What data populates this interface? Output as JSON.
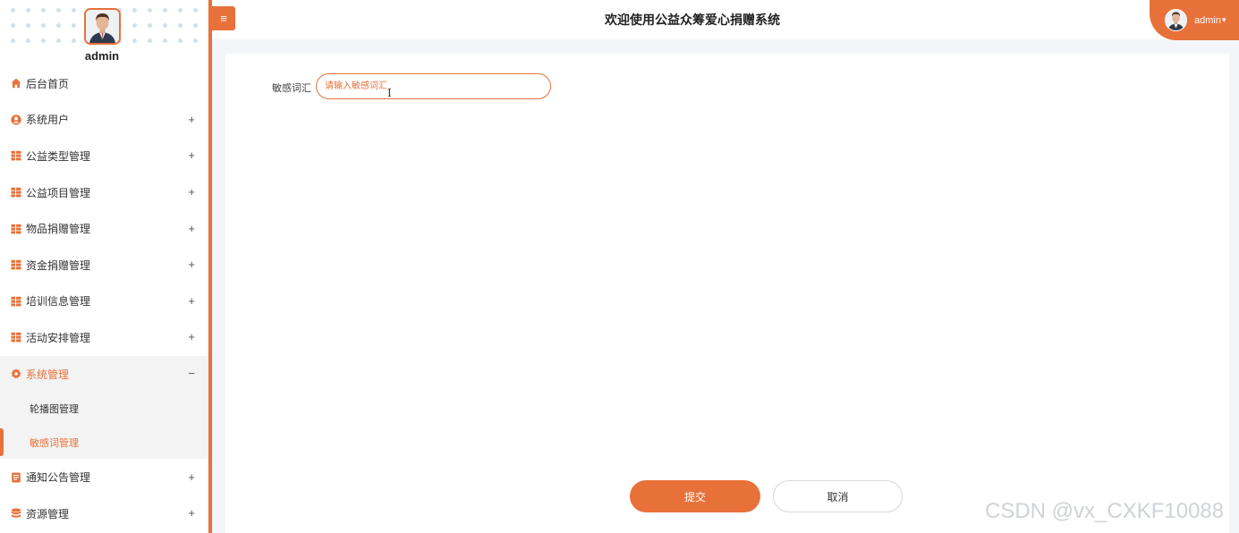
{
  "profile": {
    "name": "admin"
  },
  "header": {
    "title": "欢迎使用公益众筹爱心捐赠系统",
    "user": "admin"
  },
  "colors": {
    "accent": "#e8713a"
  },
  "menu": [
    {
      "label": "后台首页",
      "icon": "home-icon",
      "toggle": ""
    },
    {
      "label": "系统用户",
      "icon": "user-icon",
      "toggle": "+"
    },
    {
      "label": "公益类型管理",
      "icon": "grid-icon",
      "toggle": "+"
    },
    {
      "label": "公益项目管理",
      "icon": "grid-icon",
      "toggle": "+"
    },
    {
      "label": "物品捐赠管理",
      "icon": "grid-icon",
      "toggle": "+"
    },
    {
      "label": "资金捐赠管理",
      "icon": "grid-icon",
      "toggle": "+"
    },
    {
      "label": "培训信息管理",
      "icon": "grid-icon",
      "toggle": "+"
    },
    {
      "label": "活动安排管理",
      "icon": "grid-icon",
      "toggle": "+"
    },
    {
      "label": "系统管理",
      "icon": "gear-icon",
      "toggle": "−",
      "expanded": true,
      "children": [
        {
          "label": "轮播图管理"
        },
        {
          "label": "敏感词管理",
          "active": true
        }
      ]
    },
    {
      "label": "通知公告管理",
      "icon": "notice-icon",
      "toggle": "+"
    },
    {
      "label": "资源管理",
      "icon": "database-icon",
      "toggle": "+"
    }
  ],
  "form": {
    "field_label": "敏感词汇",
    "field_placeholder": "请输入敏感词汇",
    "field_value": "",
    "submit_label": "提交",
    "cancel_label": "取消"
  },
  "watermark": "CSDN @vx_CXKF10088"
}
